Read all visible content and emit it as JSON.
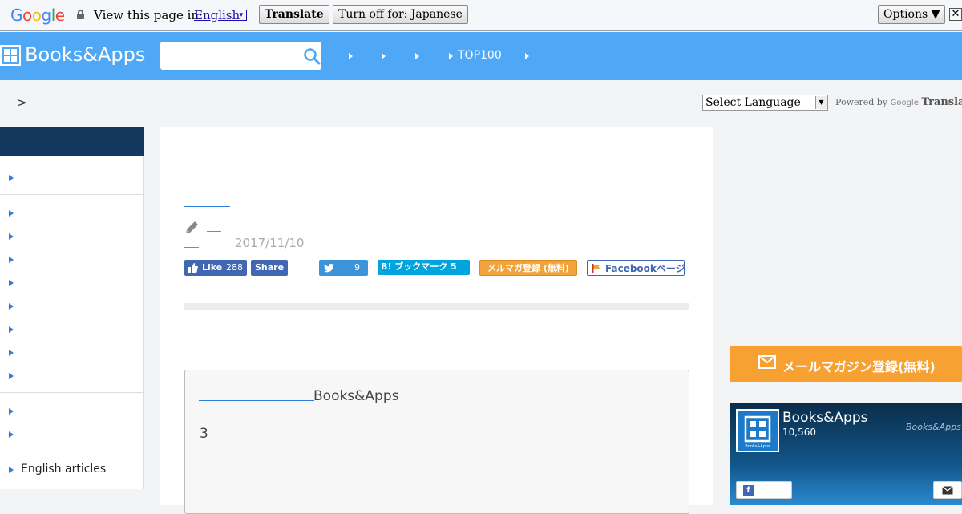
{
  "translate_bar": {
    "logo": {
      "G": "G",
      "o1": "o",
      "o2": "o",
      "g": "g",
      "l": "l",
      "e": "e"
    },
    "view_text": "View this page in:",
    "language": "English",
    "dropdown_glyph": "▾",
    "translate_label": "Translate",
    "turn_off_label": "Turn off for: Japanese",
    "options_label": "Options ▼",
    "close_glyph": "✕"
  },
  "header": {
    "brand": "Books&Apps",
    "nav_top100": "TOP100",
    "accent_color": "#4ea8f5"
  },
  "breadcrumb": {
    "separator": ">"
  },
  "language_widget": {
    "select_label": "Select Language",
    "powered_by": "Powered by",
    "google": "Google",
    "translate": "Translate"
  },
  "sidebar": {
    "items": [
      {
        "label": ""
      },
      {
        "label": ""
      },
      {
        "label": ""
      },
      {
        "label": ""
      },
      {
        "label": ""
      },
      {
        "label": ""
      },
      {
        "label": ""
      },
      {
        "label": ""
      },
      {
        "label": ""
      },
      {
        "label": ""
      },
      {
        "label": ""
      },
      {
        "label": "English articles"
      }
    ]
  },
  "article": {
    "date": "2017/11/10",
    "share": {
      "like_label": "Like",
      "like_count": "288",
      "share_label": "Share",
      "tweet_count": "9",
      "hatena_label": "B! ブックマーク 5",
      "mail_label": "メルマガ登録 (無料)",
      "fb_page_label": "Facebookページ"
    },
    "content_brand": "Books&Apps",
    "content_number": "3"
  },
  "right_column": {
    "mail_cta_label": "メールマガジン登録(無料)",
    "fb_widget": {
      "page_name": "Books&Apps",
      "followers": "10,560",
      "brand_watermark": "Books&Apps"
    }
  }
}
